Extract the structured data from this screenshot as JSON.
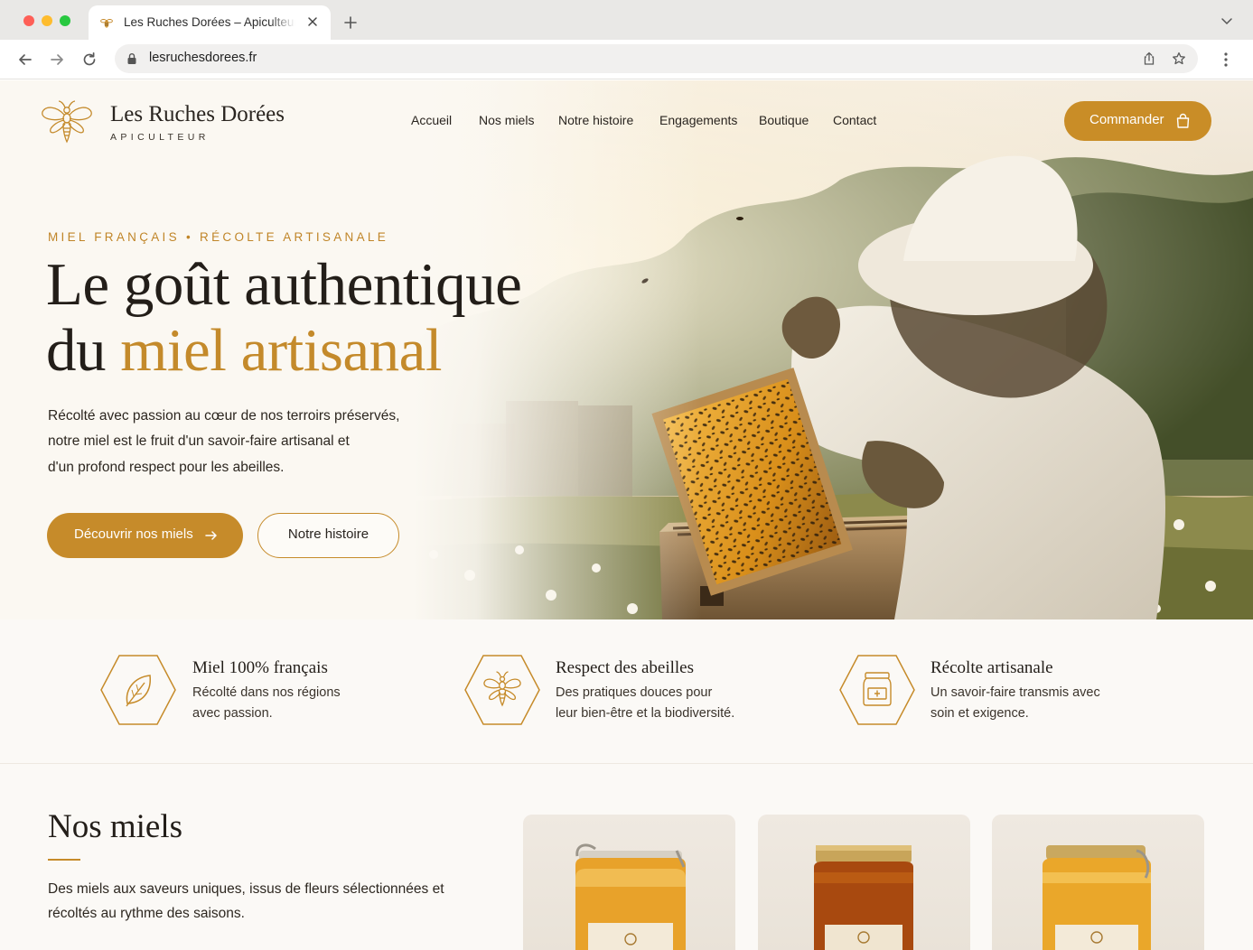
{
  "browser": {
    "tab_title": "Les Ruches Dorées – Apiculteur",
    "url": "lesruchesdorees.fr"
  },
  "header": {
    "brand": "Les Ruches Dorées",
    "brand_sub": "APICULTEUR",
    "nav": [
      "Accueil",
      "Nos miels",
      "Notre histoire",
      "Engagements",
      "Boutique",
      "Contact"
    ],
    "cta": "Commander"
  },
  "hero": {
    "eyebrow": "MIEL FRANÇAIS • RÉCOLTE ARTISANALE",
    "title_line1": "Le goût authentique",
    "title_line2_start": "du ",
    "title_line2_accent": "miel artisanal",
    "lead": [
      "Récolté avec passion au cœur de nos terroirs préservés,",
      "notre miel est le fruit d'un savoir-faire artisanal et",
      "d'un profond respect pour les abeilles."
    ],
    "btn_primary": "Découvrir nos miels",
    "btn_secondary": "Notre histoire"
  },
  "features": [
    {
      "icon": "leaf-icon",
      "title": "Miel 100% français",
      "text": [
        "Récolté dans nos régions",
        "avec passion."
      ]
    },
    {
      "icon": "bee-icon",
      "title": "Respect des abeilles",
      "text": [
        "Des pratiques douces pour",
        "leur bien-être et la biodiversité."
      ]
    },
    {
      "icon": "honey-jar-icon",
      "title": "Récolte artisanale",
      "text": [
        "Un savoir-faire transmis avec",
        "soin et exigence."
      ]
    }
  ],
  "products": {
    "title": "Nos miels",
    "text": [
      "Des miels aux saveurs uniques, issus de fleurs sélectionnées et",
      "récoltés au rythme des saisons."
    ]
  },
  "colors": {
    "accent": "#c68b2a",
    "text_dark": "#231e19",
    "page_bg": "#fbf9f6"
  }
}
